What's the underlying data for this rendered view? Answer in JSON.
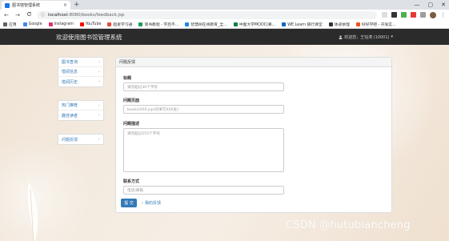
{
  "browser": {
    "tab_title": "图书馆管理系统",
    "tab_close": "×",
    "new_tab": "+",
    "window_controls": [
      "—",
      "▢",
      "✕"
    ],
    "nav": {
      "back": "←",
      "forward": "→",
      "reload": "C"
    },
    "url_host": "localhost",
    "url_path": ":8080/books/feedback.jsp",
    "bookmarks": [
      {
        "label": "应用",
        "color": "#5f6368"
      },
      {
        "label": "Google",
        "color": "#4285f4"
      },
      {
        "label": "Instagram",
        "color": "#e1306c"
      },
      {
        "label": "YouTube",
        "color": "#ff0000"
      },
      {
        "label": "超星学习通",
        "color": "#e84a3a"
      },
      {
        "label": "简书教程 - 学后不...",
        "color": "#1a9c5b"
      },
      {
        "label": "智慧树在线教育_全...",
        "color": "#1e88e5"
      },
      {
        "label": "中国大学MOOC(慕...",
        "color": "#0b8043"
      },
      {
        "label": "WE Learn 随行课堂",
        "color": "#1565c0"
      },
      {
        "label": "体递依理",
        "color": "#333333"
      },
      {
        "label": "好好学吧 - 开发实...",
        "color": "#f4511e"
      }
    ]
  },
  "navbar": {
    "brand": "欢迎使用图书馆管理系统",
    "user": "欢迎您，王钰涛 (10001)",
    "user_caret": "▾",
    "user_icon": "user-icon"
  },
  "sidebar": {
    "groups": [
      {
        "items": [
          "图书查询",
          "借阅信息",
          "借阅历史"
        ]
      },
      {
        "items": [
          "热门推荐",
          "趣佳读者"
        ]
      },
      {
        "items": [
          "问题反馈"
        ]
      }
    ],
    "chevron": "›"
  },
  "panel": {
    "heading": "问题反馈",
    "fields": {
      "title_label": "标题",
      "title_placeholder": "请勿超过30个字符",
      "page_label": "问题页面",
      "page_placeholder": "books/XXX.jsp(仅填写XXX处)",
      "desc_label": "问题描述",
      "desc_placeholder": "请勿超过255个字符",
      "contact_label": "联系方式",
      "contact_placeholder": "电话/邮箱"
    },
    "submit_label": "提 交",
    "my_feedback_label": "我的反馈",
    "my_feedback_arrow": "›"
  },
  "watermark": "CSDN @hutubiancheng",
  "colors": {
    "navbar_bg": "#2b2b2b",
    "link": "#337ab7",
    "primary_button": "#337ab7"
  }
}
